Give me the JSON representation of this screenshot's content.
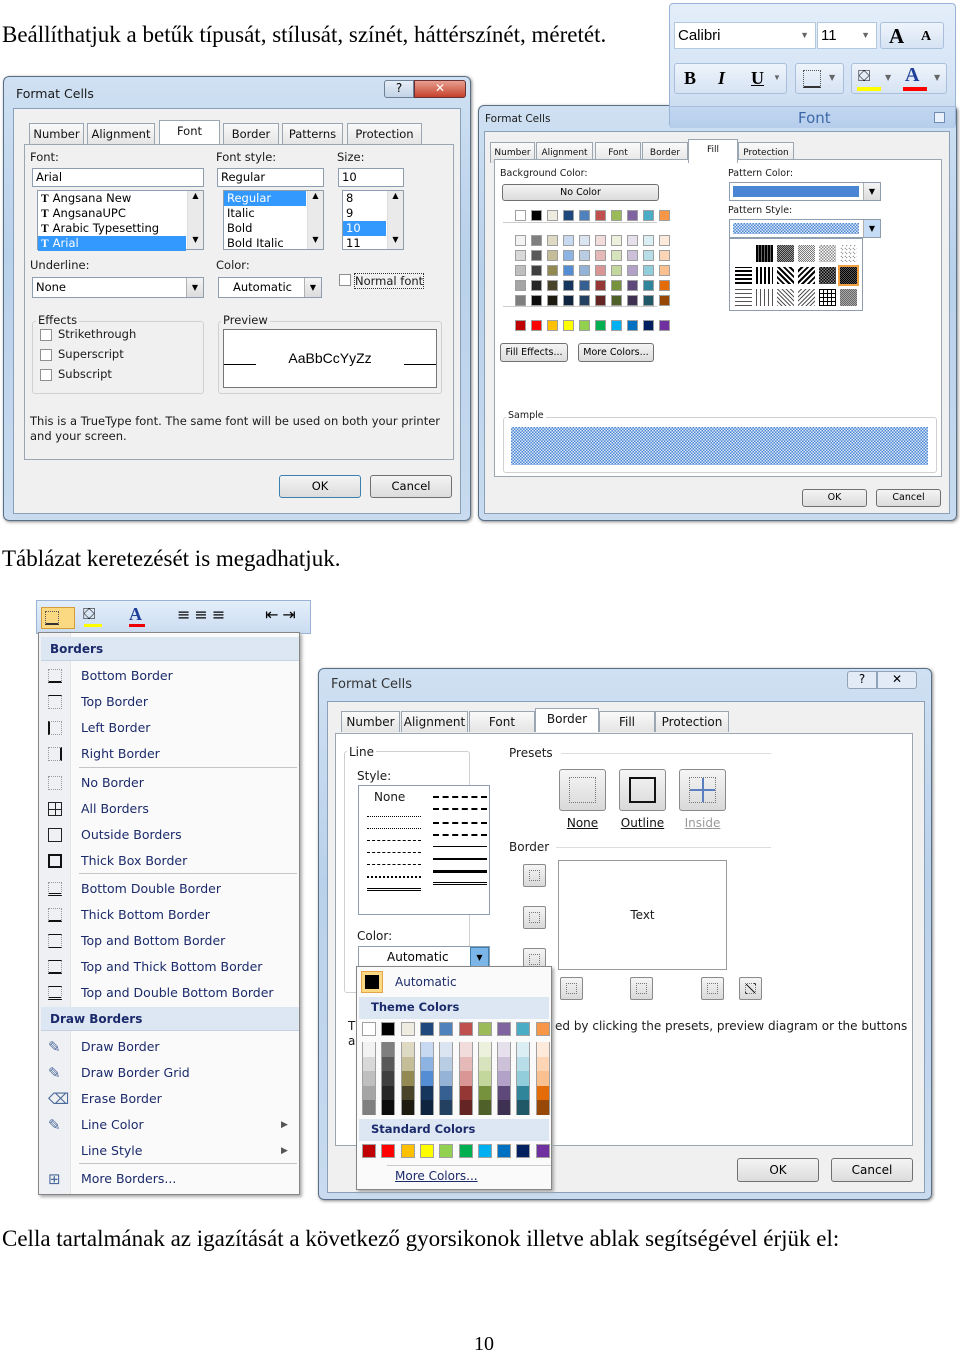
{
  "doc": {
    "para1": "Beállíthatjuk a betűk típusát, stílusát, színét, háttérszínét, méretét.",
    "para2": "Táblázat keretezését is megadhatjuk.",
    "para3": "Cella tartalmának az igazítását a következő gyorsikonok illetve ablak segítségével érjük el:",
    "page_number": "10"
  },
  "font_dialog": {
    "title": "Format Cells",
    "tabs": [
      "Number",
      "Alignment",
      "Font",
      "Border",
      "Patterns",
      "Protection"
    ],
    "selected_tab": "Font",
    "font_label": "Font:",
    "font_value": "Arial",
    "font_list": [
      "Angsana New",
      "AngsanaUPC",
      "Arabic Typesetting",
      "Arial"
    ],
    "style_label": "Font style:",
    "style_value": "Regular",
    "style_list": [
      "Regular",
      "Italic",
      "Bold",
      "Bold Italic"
    ],
    "size_label": "Size:",
    "size_value": "10",
    "size_list": [
      "8",
      "9",
      "10",
      "11"
    ],
    "underline_label": "Underline:",
    "underline_value": "None",
    "color_label": "Color:",
    "color_value": "Automatic",
    "normal_font": "Normal font",
    "effects_label": "Effects",
    "effects": [
      "Strikethrough",
      "Superscript",
      "Subscript"
    ],
    "preview_label": "Preview",
    "preview_text": "AaBbCcYyZz",
    "note_line1": "This is a TrueType font.  The same font will be used on both your printer",
    "note_line2": "and your screen.",
    "ok": "OK",
    "cancel": "Cancel"
  },
  "ribbon": {
    "font_name": "Calibri",
    "font_size": "11",
    "group_label": "Font",
    "bold": "B",
    "italic": "I",
    "underline": "U",
    "font_color_glyph": "A",
    "fill_color": "#ffff00",
    "font_color": "#ff0000"
  },
  "fill_dialog": {
    "title": "Format Cells",
    "tabs": [
      "Number",
      "Alignment",
      "Font",
      "Border",
      "Fill",
      "Protection"
    ],
    "selected_tab": "Fill",
    "bg_label": "Background Color:",
    "no_color": "No Color",
    "pattern_color_label": "Pattern Color:",
    "pattern_color": "#4a86d4",
    "pattern_style_label": "Pattern Style:",
    "fill_effects": "Fill Effects...",
    "more_colors": "More Colors...",
    "sample_label": "Sample",
    "ok": "OK",
    "cancel": "Cancel"
  },
  "palette": {
    "theme": [
      "#ffffff",
      "#000000",
      "#eeece1",
      "#1f497d",
      "#4f81bd",
      "#c0504d",
      "#9bbb59",
      "#8064a2",
      "#4bacc6",
      "#f79646"
    ],
    "shades": [
      [
        "#f2f2f2",
        "#7f7f7f",
        "#ddd9c3",
        "#c6d9f0",
        "#dbe5f1",
        "#f2dcdb",
        "#ebf1dd",
        "#e5e0ec",
        "#dbeef3",
        "#fdeada"
      ],
      [
        "#d8d8d8",
        "#595959",
        "#c4bd97",
        "#8db3e2",
        "#b8cce4",
        "#e5b9b7",
        "#d7e3bc",
        "#ccc1d9",
        "#b7dde8",
        "#fbd5b5"
      ],
      [
        "#bfbfbf",
        "#3f3f3f",
        "#938953",
        "#548dd4",
        "#95b3d7",
        "#d99694",
        "#c3d69b",
        "#b2a2c7",
        "#92cddc",
        "#fac08f"
      ],
      [
        "#a5a5a5",
        "#262626",
        "#494429",
        "#17365d",
        "#366092",
        "#953734",
        "#76923c",
        "#5f497a",
        "#31859b",
        "#e36c09"
      ],
      [
        "#7f7f7f",
        "#0c0c0c",
        "#1d1b10",
        "#0f243e",
        "#244061",
        "#632423",
        "#4f6128",
        "#3f3151",
        "#205867",
        "#974806"
      ]
    ],
    "standard": [
      "#c00000",
      "#ff0000",
      "#ffc000",
      "#ffff00",
      "#92d050",
      "#00b050",
      "#00b0f0",
      "#0070c0",
      "#002060",
      "#7030a0"
    ]
  },
  "borders_menu": {
    "header": "Borders",
    "items": [
      "Bottom Border",
      "Top Border",
      "Left Border",
      "Right Border",
      "No Border",
      "All Borders",
      "Outside Borders",
      "Thick Box Border",
      "Bottom Double Border",
      "Thick Bottom Border",
      "Top and Bottom Border",
      "Top and Thick Bottom Border",
      "Top and Double Bottom Border"
    ],
    "draw_header": "Draw Borders",
    "draw_items": [
      "Draw Border",
      "Draw Border Grid",
      "Erase Border",
      "Line Color",
      "Line Style",
      "More Borders..."
    ]
  },
  "border_dialog": {
    "title": "Format Cells",
    "tabs": [
      "Number",
      "Alignment",
      "Font",
      "Border",
      "Fill",
      "Protection"
    ],
    "selected_tab": "Border",
    "line_label": "Line",
    "style_label": "Style:",
    "style_none": "None",
    "color_label": "Color:",
    "color_value": "Automatic",
    "presets_label": "Presets",
    "presets": [
      "None",
      "Outline",
      "Inside"
    ],
    "border_label": "Border",
    "preview_text": "Text",
    "note_frag1": "Th",
    "note_frag2": "ed by clicking the presets, preview diagram or the buttons",
    "note_frag3": "ab",
    "ok": "OK",
    "cancel": "Cancel",
    "dropdown": {
      "automatic": "Automatic",
      "theme_header": "Theme Colors",
      "standard_header": "Standard Colors",
      "more": "More Colors..."
    }
  }
}
